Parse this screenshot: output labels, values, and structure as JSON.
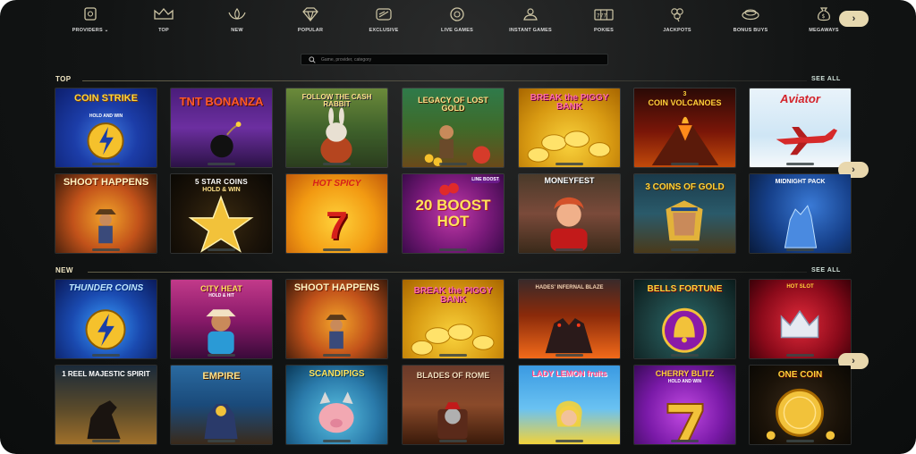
{
  "nav": {
    "items": [
      {
        "label": "PROVIDERS",
        "icon": "providers-icon"
      },
      {
        "label": "TOP",
        "icon": "crown-icon"
      },
      {
        "label": "NEW",
        "icon": "lotus-icon"
      },
      {
        "label": "POPULAR",
        "icon": "diamond-icon"
      },
      {
        "label": "EXCLUSIVE",
        "icon": "exclusive-icon"
      },
      {
        "label": "LIVE GAMES",
        "icon": "chip-icon"
      },
      {
        "label": "INSTANT GAMES",
        "icon": "instant-icon"
      },
      {
        "label": "POKIES",
        "icon": "slot-reels-icon"
      },
      {
        "label": "JACKPOTS",
        "icon": "clover-icon"
      },
      {
        "label": "BONUS BUYS",
        "icon": "bonus-icon"
      },
      {
        "label": "MEGAWAYS",
        "icon": "money-bag-icon"
      }
    ],
    "providers_arrow": "⌄",
    "next": "›"
  },
  "search": {
    "placeholder": "Game, provider, category"
  },
  "top": {
    "title": "TOP",
    "see_all": "SEE ALL",
    "next": "›",
    "games": [
      {
        "name": "COIN STRIKE",
        "sub": "HOLD AND WIN"
      },
      {
        "name": "TNT BONANZA",
        "sub": ""
      },
      {
        "name": "FOLLOW THE CASH RABBIT",
        "sub": ""
      },
      {
        "name": "LEGACY OF LOST GOLD",
        "sub": ""
      },
      {
        "name": "BREAK the PIGGY BANK",
        "sub": ""
      },
      {
        "name": "COIN VOLCANOES",
        "sub": "3"
      },
      {
        "name": "Aviator",
        "sub": ""
      },
      {
        "name": "SHOOT HAPPENS",
        "sub": ""
      },
      {
        "name": "5 STAR COINS",
        "sub": "HOLD & WIN"
      },
      {
        "name": "HOT SPICY",
        "sub": "7"
      },
      {
        "name": "20 BOOST HOT",
        "sub": "LINE BOOST"
      },
      {
        "name": "MONEYFEST",
        "sub": ""
      },
      {
        "name": "3 COINS OF GOLD",
        "sub": ""
      },
      {
        "name": "MIDNIGHT PACK",
        "sub": ""
      }
    ]
  },
  "new": {
    "title": "NEW",
    "see_all": "SEE ALL",
    "next": "›",
    "games": [
      {
        "name": "THUNDER COINS",
        "sub": ""
      },
      {
        "name": "CITY HEAT",
        "sub": "HOLD & HIT"
      },
      {
        "name": "SHOOT HAPPENS",
        "sub": ""
      },
      {
        "name": "BREAK the PIGGY BANK",
        "sub": ""
      },
      {
        "name": "HADES' INFERNAL BLAZE",
        "sub": ""
      },
      {
        "name": "BELLS FORTUNE",
        "sub": ""
      },
      {
        "name": "HOT SLOT",
        "sub": ""
      },
      {
        "name": "1 REEL MAJESTIC SPIRIT",
        "sub": ""
      },
      {
        "name": "EMPIRE",
        "sub": ""
      },
      {
        "name": "SCANDIPIGS",
        "sub": ""
      },
      {
        "name": "BLADES OF ROME",
        "sub": ""
      },
      {
        "name": "LADY LEMON fruits",
        "sub": ""
      },
      {
        "name": "CHERRY BLITZ",
        "sub": "HOLD AND WIN"
      },
      {
        "name": "ONE COIN",
        "sub": ""
      }
    ]
  }
}
